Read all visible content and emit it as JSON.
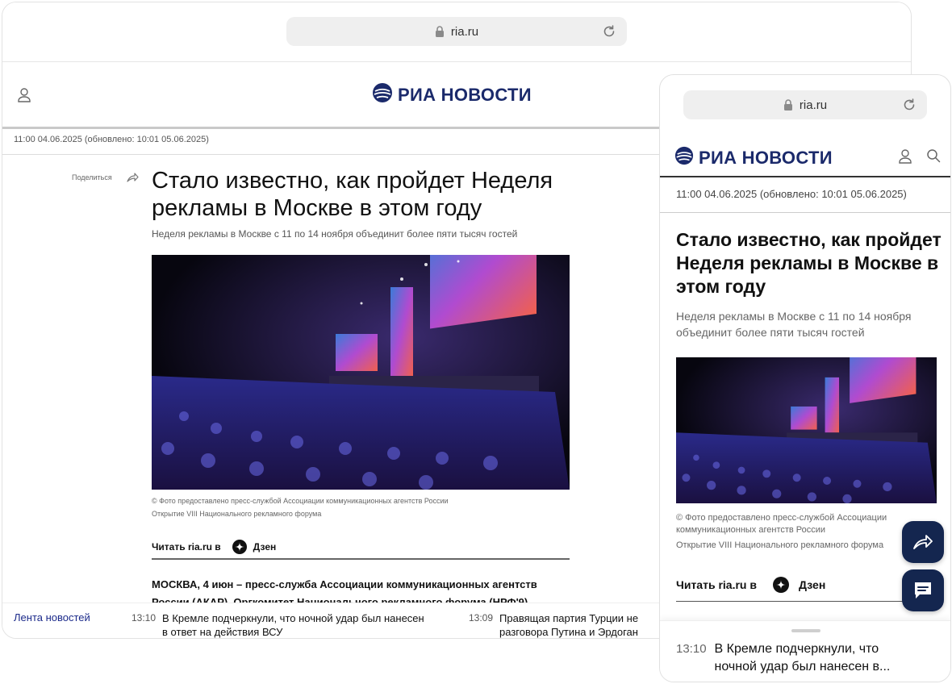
{
  "desktop": {
    "url": "ria.ru",
    "logo_text": "РИА НОВОСТИ",
    "date_line": "11:00 04.06.2025   (обновлено: 10:01 05.06.2025)",
    "share_label": "Поделиться",
    "title": "Стало известно, как пройдет Неделя рекламы в Москве в этом году",
    "subtitle": "Неделя рекламы в Москве с 11 по 14 ноября объединит более пяти тысяч гостей",
    "photo_caption_1": "© Фото предоставлено пресс-службой Ассоциации коммуникационных агентств России",
    "photo_caption_2": "Открытие VIII Национального рекламного форума",
    "read_in_label": "Читать ria.ru в",
    "zen_label": "Дзен",
    "body_text": "МОСКВА, 4 июн – пресс-служба Ассоциации коммуникационных агентств России (АКАР). Оргкомитет Национального рекламного форума (НРФ'9)",
    "feed": {
      "label": "Лента новостей",
      "items": [
        {
          "time": "13:10",
          "text": "В Кремле подчеркнули, что ночной удар был нанесен в ответ на действия ВСУ"
        },
        {
          "time": "13:09",
          "text": "Правящая партия Турции не разговора Путина и Эрдоган"
        }
      ]
    }
  },
  "mobile": {
    "url": "ria.ru",
    "logo_text": "РИА НОВОСТИ",
    "date_line": "11:00 04.06.2025   (обновлено: 10:01 05.06.2025)",
    "title": "Стало известно, как пройдет Неделя рекламы в Москве в этом году",
    "subtitle": "Неделя рекламы в Москве с 11 по 14 ноября объединит более пяти тысяч гостей",
    "photo_caption_1": "© Фото предоставлено пресс-службой Ассоциации коммуникационных агентств России",
    "photo_caption_2": "Открытие VIII Национального рекламного форума",
    "read_in_label": "Читать ria.ru в",
    "zen_label": "Дзен",
    "news_time": "13:10",
    "news_text": "В Кремле подчеркнули, что ночной удар был нанесен в..."
  },
  "colors": {
    "brand": "#1b2a6b",
    "fab": "#14264f",
    "feed_label": "#1b2a8a"
  },
  "icons": [
    "lock-icon",
    "reload-icon",
    "user-icon",
    "search-icon",
    "share-icon",
    "zen-icon",
    "chat-icon"
  ]
}
